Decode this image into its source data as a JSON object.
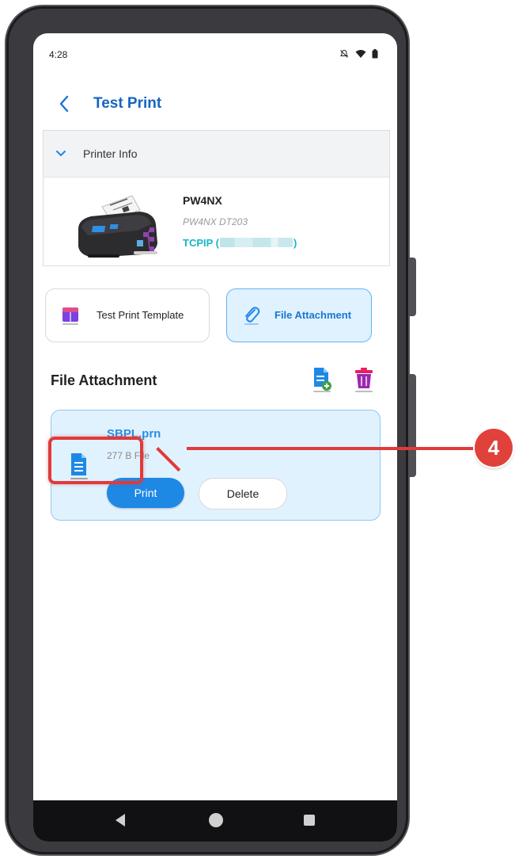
{
  "status_bar": {
    "time": "4:28",
    "icons": [
      "notifications-off-icon",
      "wifi-icon",
      "battery-icon"
    ]
  },
  "header": {
    "title": "Test Print",
    "back_icon": "chevron-left-icon"
  },
  "printer_info": {
    "section_label": "Printer Info",
    "expanded": true,
    "name": "PW4NX",
    "model": "PW4NX DT203",
    "connection_prefix": "TCPIP (",
    "connection_suffix": ")"
  },
  "tabs": [
    {
      "label": "Test Print Template",
      "icon": "template-icon",
      "active": false
    },
    {
      "label": "File Attachment",
      "icon": "paperclip-icon",
      "active": true
    }
  ],
  "file_section": {
    "title": "File Attachment",
    "actions": [
      "add-file-icon",
      "trash-icon"
    ]
  },
  "file": {
    "name": "SBPL.prn",
    "size": "277 B File",
    "print_label": "Print",
    "delete_label": "Delete"
  },
  "annotation": {
    "step_number": "4"
  },
  "colors": {
    "accent": "#1e88e5",
    "title_blue": "#1565c0",
    "connection_teal": "#14b8c4",
    "highlight_red": "#e03a3a",
    "card_bg": "#e1f2ff"
  }
}
